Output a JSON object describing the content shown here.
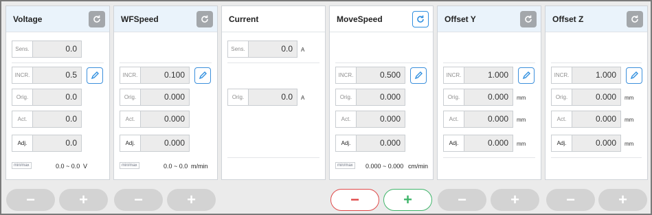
{
  "panels": [
    {
      "title": "Voltage",
      "sens": "0.0",
      "incr": "0.5",
      "orig": "0.0",
      "act": "0.0",
      "adj": "0.0",
      "range": "0.0 ~ 0.0",
      "range_unit": "V"
    },
    {
      "title": "WFSpeed",
      "incr": "0.100",
      "orig": "0.000",
      "act": "0.000",
      "adj": "0.000",
      "range": "0.0 ~ 0.0",
      "range_unit": "m/min"
    },
    {
      "title": "Current",
      "sens": "0.0",
      "orig": "0.0",
      "unit": "A"
    },
    {
      "title": "MoveSpeed",
      "incr": "0.500",
      "orig": "0.000",
      "act": "0.000",
      "adj": "0.000",
      "range": "0.000 ~ 0.000",
      "range_unit": "cm/min"
    },
    {
      "title": "Offset Y",
      "incr": "1.000",
      "orig": "0.000",
      "act": "0.000",
      "adj": "0.000",
      "unit": "mm"
    },
    {
      "title": "Offset Z",
      "incr": "1.000",
      "orig": "0.000",
      "act": "0.000",
      "adj": "0.000",
      "unit": "mm"
    }
  ],
  "labels": {
    "sens": "Sens.",
    "incr": "INCR.",
    "orig": "Orig.",
    "act": "Act.",
    "adj": "Adj.",
    "minmax": "min/max"
  },
  "buttons": {
    "minus": "−",
    "plus": "+"
  },
  "colors": {
    "accent": "#2f8fe0",
    "minus_active": "#e04848",
    "plus_active": "#3fb56a",
    "reset_inactive": "#a3a7ab"
  }
}
